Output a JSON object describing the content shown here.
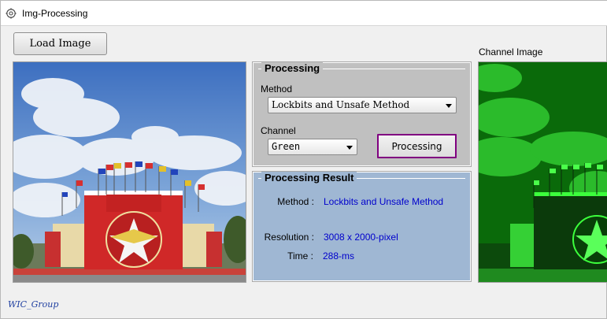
{
  "window": {
    "title": "Img-Processing"
  },
  "toolbar": {
    "load_label": "Load Image"
  },
  "channel_image": {
    "caption": "Channel Image"
  },
  "processing": {
    "group_title": "Processing",
    "method_label": "Method",
    "method_selected": "Lockbits and Unsafe Method",
    "channel_label": "Channel",
    "channel_selected": "Green",
    "process_label": "Processing"
  },
  "result": {
    "group_title": "Processing Result",
    "method_key": "Method :",
    "method_value": "Lockbits and Unsafe Method",
    "resolution_key": "Resolution :",
    "resolution_value": "3008 x 2000-pixel",
    "time_key": "Time :",
    "time_value": "288-ms"
  },
  "footer": {
    "credit": "WIC_Group"
  },
  "colors": {
    "processing_bg": "#c0c0c0",
    "result_bg": "#9fb7d3",
    "value_text": "#0000cc",
    "process_button_border": "#800080",
    "channel_tint": "#00ff00"
  },
  "icons": {
    "app": "gear-icon"
  }
}
